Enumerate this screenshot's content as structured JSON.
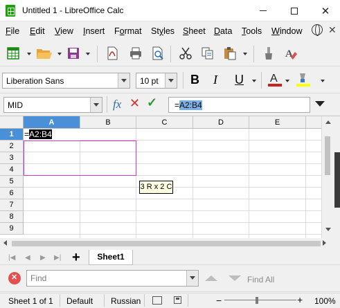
{
  "window": {
    "title": "Untitled 1 - LibreOffice Calc"
  },
  "menu": {
    "items": [
      {
        "label": "File",
        "u": "F",
        "rest": "ile"
      },
      {
        "label": "Edit",
        "u": "E",
        "rest": "dit"
      },
      {
        "label": "View",
        "u": "V",
        "rest": "iew"
      },
      {
        "label": "Insert",
        "u": "I",
        "rest": "nsert"
      },
      {
        "label": "Format",
        "u": "o",
        "pre": "F",
        "rest": "rmat"
      },
      {
        "label": "Styles",
        "u": "y",
        "pre": "St",
        "rest": "les"
      },
      {
        "label": "Sheet",
        "u": "S",
        "rest": "heet"
      },
      {
        "label": "Data",
        "u": "D",
        "rest": "ata"
      },
      {
        "label": "Tools",
        "u": "T",
        "rest": "ools"
      },
      {
        "label": "Window",
        "u": "W",
        "rest": "indow"
      }
    ]
  },
  "format": {
    "font_name": "Liberation Sans",
    "font_size": "10 pt",
    "bold": "B",
    "italic": "I",
    "underline": "U",
    "font_color": "#c9211e",
    "highlight_color": "#ffff00"
  },
  "formula": {
    "name_box": "MID",
    "fx": "fx",
    "prefix": "=",
    "ref": "A2:B4"
  },
  "grid": {
    "columns": [
      "A",
      "B",
      "C",
      "D",
      "E"
    ],
    "rows": [
      "1",
      "2",
      "3",
      "4",
      "5",
      "6",
      "7",
      "8",
      "9"
    ],
    "active_column": "A",
    "active_row": "1",
    "cell_a1_prefix": "=",
    "cell_a1_ref": "A2:B4",
    "selection_color": "#c43ac4",
    "tooltip": "3 R x 2 C"
  },
  "sheets": {
    "add": "+",
    "tabs": [
      "Sheet1"
    ]
  },
  "find": {
    "placeholder": "Find",
    "find_all": "Find All"
  },
  "status": {
    "sheet": "Sheet 1 of 1",
    "page_style": "Default",
    "language": "Russian",
    "zoom": "100%",
    "zoom_minus": "−",
    "zoom_plus": "+"
  }
}
